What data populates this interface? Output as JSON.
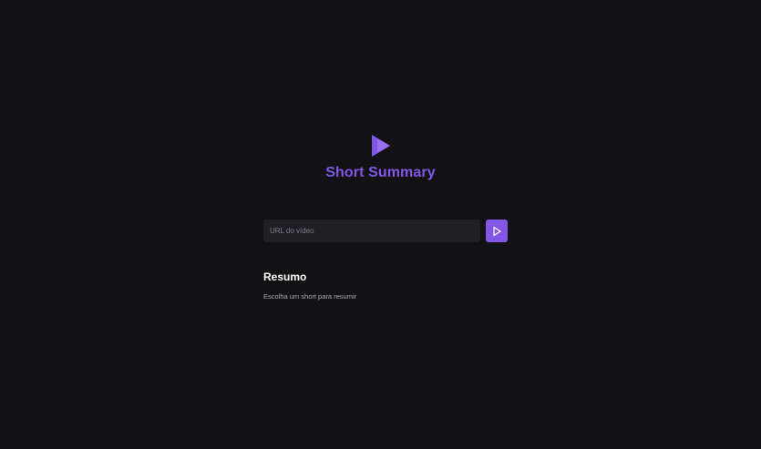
{
  "app": {
    "title": "Short Summary"
  },
  "search": {
    "placeholder": "URL do vídeo",
    "value": ""
  },
  "summary": {
    "title": "Resumo",
    "text": "Escolha um short para resumir"
  },
  "icons": {
    "logo": "play-icon",
    "submit": "play-outline-icon"
  },
  "colors": {
    "background": "#121214",
    "accent": "#8257e5",
    "input_background": "#202024"
  }
}
